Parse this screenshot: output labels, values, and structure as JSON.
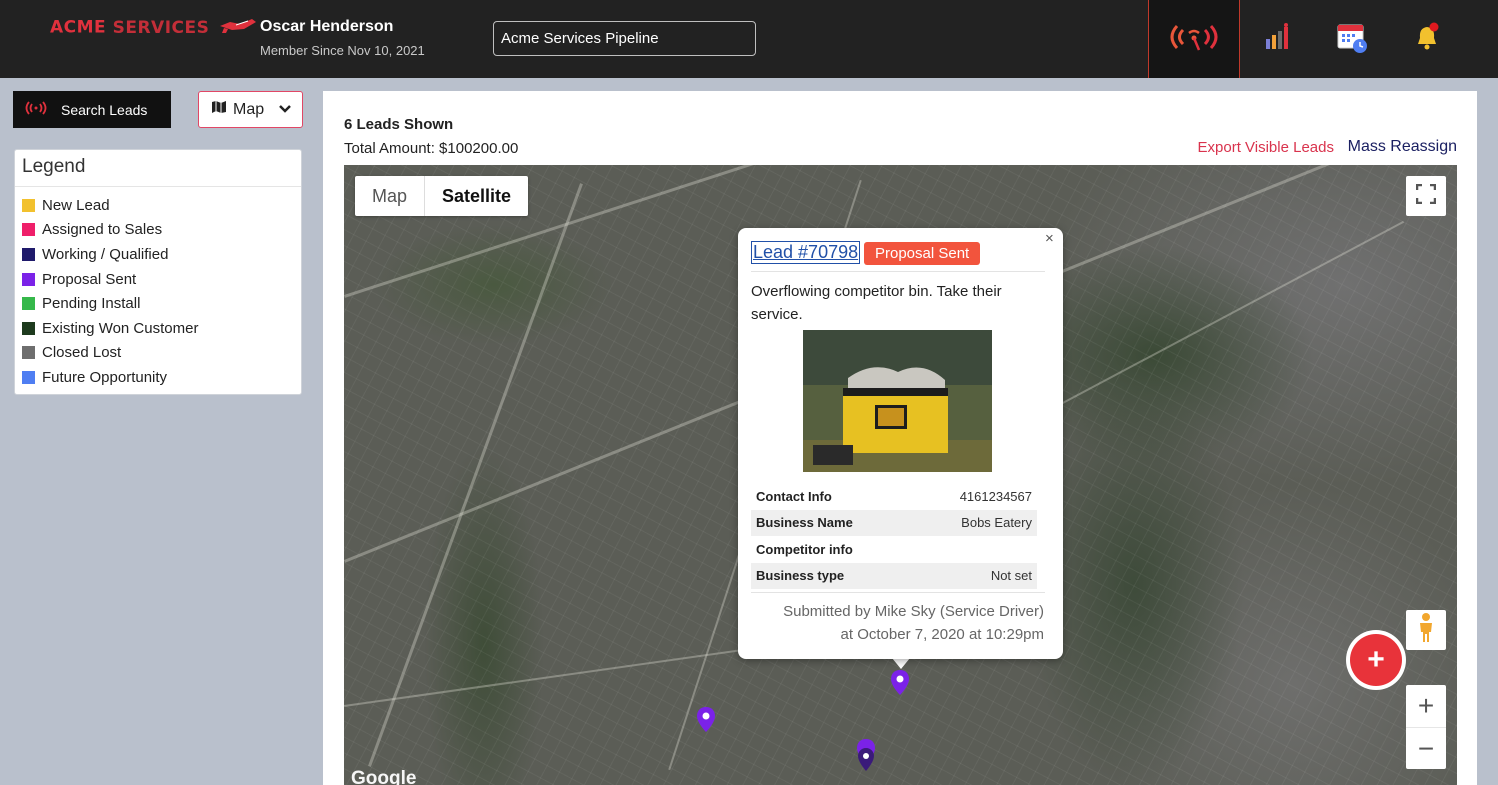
{
  "header": {
    "logo_text_1": "ACME",
    "logo_text_2": "SERVICES",
    "user_name": "Oscar Henderson",
    "member_since": "Member Since Nov 10, 2021",
    "pipeline_value": "Acme Services Pipeline",
    "nav_icons": [
      "signal-icon",
      "bar-chart-icon",
      "calendar-clock-icon",
      "bell-icon"
    ]
  },
  "sidebar": {
    "search_label": "Search Leads",
    "view_select": "Map",
    "legend_title": "Legend",
    "legend_items": [
      {
        "label": "New Lead",
        "color": "#f2c12e"
      },
      {
        "label": "Assigned to Sales",
        "color": "#ef1f6a"
      },
      {
        "label": "Working / Qualified",
        "color": "#1f1a6b"
      },
      {
        "label": "Proposal Sent",
        "color": "#7b22e8"
      },
      {
        "label": "Pending Install",
        "color": "#35b84a"
      },
      {
        "label": "Existing Won Customer",
        "color": "#1d3a1d"
      },
      {
        "label": "Closed Lost",
        "color": "#6e6e6e"
      },
      {
        "label": "Future Opportunity",
        "color": "#4f7ef2"
      }
    ]
  },
  "main": {
    "leads_shown": "6 Leads Shown",
    "total_amount": "Total Amount: $100200.00",
    "export_label": "Export Visible Leads",
    "mass_reassign_label": "Mass Reassign"
  },
  "map": {
    "type_map": "Map",
    "type_satellite": "Satellite",
    "selected_type": "Satellite",
    "zoom_in": "+",
    "zoom_out": "−",
    "fab_label": "+",
    "attribution": "Google"
  },
  "popup": {
    "lead_link": "Lead #70798",
    "status": "Proposal Sent",
    "status_color": "#f2543d",
    "description": "Overflowing competitor bin. Take their service.",
    "fields": [
      {
        "key": "Contact Info",
        "value": "4161234567"
      },
      {
        "key": "Business Name",
        "value": "Bobs Eatery"
      },
      {
        "key": "Competitor info",
        "value": ""
      },
      {
        "key": "Business type",
        "value": "Not set"
      }
    ],
    "submitted_by": "Submitted by Mike Sky (Service Driver)",
    "submitted_at": "at October 7, 2020 at 10:29pm",
    "close": "×"
  }
}
